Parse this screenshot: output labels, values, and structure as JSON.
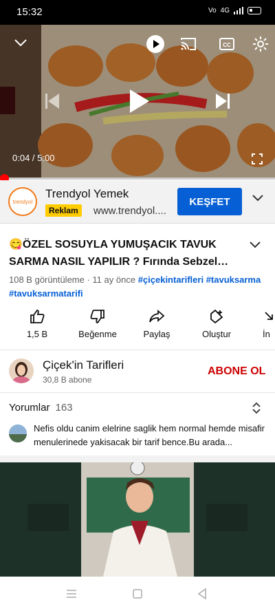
{
  "status": {
    "time": "15:32",
    "network": "4G"
  },
  "player": {
    "time_current": "0:04",
    "time_separator": " / ",
    "time_total": "5:00",
    "progress": 0.013
  },
  "ad": {
    "logo_text": "trendyol",
    "name": "Trendyol Yemek",
    "badge": "Reklam",
    "url": "www.trendyol....",
    "cta": "KEŞFET"
  },
  "video": {
    "title": "😋ÖZEL SOSUYLA YUMUŞACIK TAVUK SARMA NASIL YAPILIR ? Fırında Sebzel…",
    "views": "108 B görüntüleme",
    "sep": " · ",
    "age": "11 ay önce",
    "tags": [
      "#çiçekintarifleri",
      "#tavuksarma",
      "#tavuksarmatarifi"
    ]
  },
  "actions": [
    {
      "label": "1,5 B",
      "icon": "thumbs-up-icon"
    },
    {
      "label": "Beğenme",
      "icon": "thumbs-down-icon"
    },
    {
      "label": "Paylaş",
      "icon": "share-icon"
    },
    {
      "label": "Oluştur",
      "icon": "create-icon"
    },
    {
      "label": "İn",
      "icon": "download-icon"
    }
  ],
  "channel": {
    "name": "Çiçek'in Tarifleri",
    "subscribers": "30,8 B abone",
    "subscribe": "ABONE OL"
  },
  "comments": {
    "heading": "Yorumlar",
    "count": "163",
    "top_comment": "Nefis oldu canim elelrine saglik hem normal hemde misafir menulerinede yakisacak bir tarif bence.Bu arada..."
  },
  "colors": {
    "accent": "#065fd4",
    "brand_red": "#ff0000",
    "subscribe": "#cc0000",
    "ad_badge": "#ffcc00"
  }
}
